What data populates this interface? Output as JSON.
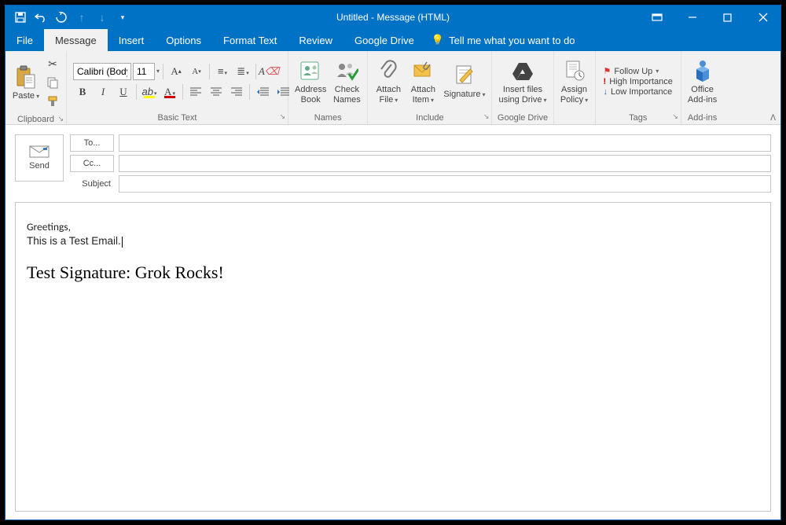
{
  "title": "Untitled  -  Message (HTML)",
  "qat": {
    "save": "save",
    "undo": "undo",
    "redo": "redo"
  },
  "tabs": {
    "file": "File",
    "message": "Message",
    "insert": "Insert",
    "options": "Options",
    "format": "Format Text",
    "review": "Review",
    "gdrive": "Google Drive",
    "tellme": "Tell me what you want to do"
  },
  "ribbon": {
    "clipboard": {
      "paste": "Paste",
      "label": "Clipboard"
    },
    "basic": {
      "font": "Calibri (Body)",
      "size": "11",
      "label": "Basic Text"
    },
    "names": {
      "address": "Address\nBook",
      "check": "Check\nNames",
      "label": "Names"
    },
    "include": {
      "attachFile": "Attach\nFile",
      "attachItem": "Attach\nItem",
      "signature": "Signature",
      "label": "Include"
    },
    "gdrive": {
      "insert": "Insert files\nusing Drive",
      "label": "Google Drive"
    },
    "assign": {
      "assign": "Assign\nPolicy",
      "label": ""
    },
    "tags": {
      "follow": "Follow Up",
      "high": "High Importance",
      "low": "Low Importance",
      "label": "Tags"
    },
    "addins": {
      "office": "Office\nAdd-ins",
      "label": "Add-ins"
    }
  },
  "compose": {
    "send": "Send",
    "to": "To...",
    "cc": "Cc...",
    "subject": "Subject",
    "to_val": "",
    "cc_val": "",
    "subject_val": ""
  },
  "body": {
    "line1": "Greetings,",
    "line2": "This is a Test Email.",
    "signature": "Test Signature: Grok Rocks!"
  }
}
